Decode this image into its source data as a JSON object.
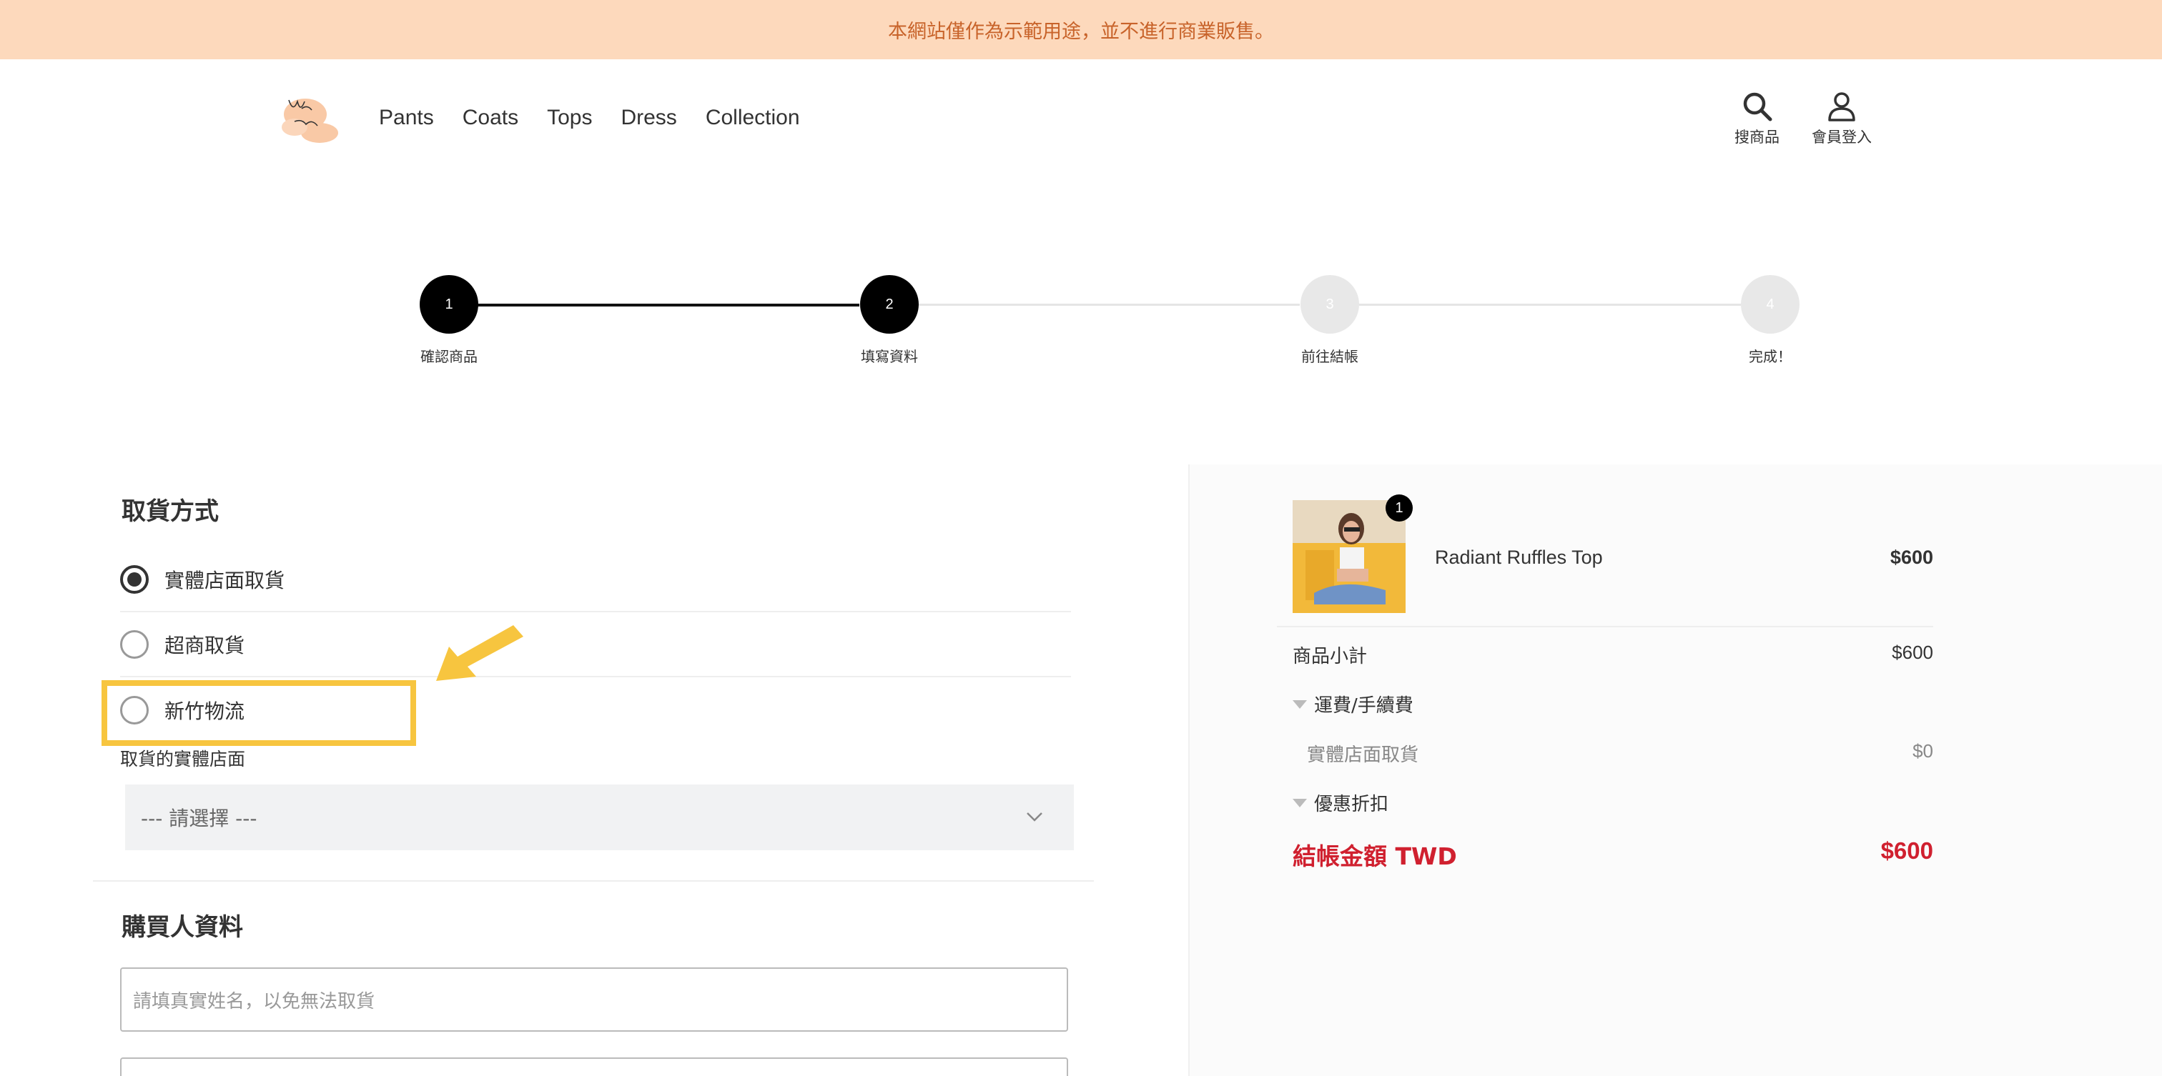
{
  "banner": {
    "text": "本網站僅作為示範用途，並不進行商業販售。"
  },
  "nav": {
    "links": [
      "Pants",
      "Coats",
      "Tops",
      "Dress",
      "Collection"
    ],
    "search_label": "搜商品",
    "account_label": "會員登入"
  },
  "steps": [
    {
      "number": "1",
      "label": "確認商品",
      "status": "done"
    },
    {
      "number": "2",
      "label": "填寫資料",
      "status": "current"
    },
    {
      "number": "3",
      "label": "前往結帳",
      "status": "pending"
    },
    {
      "number": "4",
      "label": "完成！",
      "status": "pending"
    }
  ],
  "pickup": {
    "title": "取貨方式",
    "options": [
      {
        "label": "實體店面取貨",
        "selected": true
      },
      {
        "label": "超商取貨",
        "selected": false
      },
      {
        "label": "新竹物流",
        "selected": false
      }
    ],
    "store_label": "取貨的實體店面",
    "store_select_value": "--- 請選擇 ---"
  },
  "buyer": {
    "title": "購買人資料",
    "name_placeholder": "請填真實姓名，以免無法取貨"
  },
  "order": {
    "item": {
      "name": "Radiant Ruffles Top",
      "price": "$600",
      "qty": "1"
    },
    "subtotal_label": "商品小計",
    "subtotal_value": "$600",
    "shipping_label": "運費/手續費",
    "shipping_method_label": "實體店面取貨",
    "shipping_method_value": "$0",
    "discount_label": "優惠折扣",
    "total_label": "結帳金額 TWD",
    "total_value": "$600"
  },
  "colors": {
    "banner_bg": "#fdd9bc",
    "banner_text": "#c8632a",
    "highlight": "#f7c53f",
    "total_red": "#d0202f"
  }
}
